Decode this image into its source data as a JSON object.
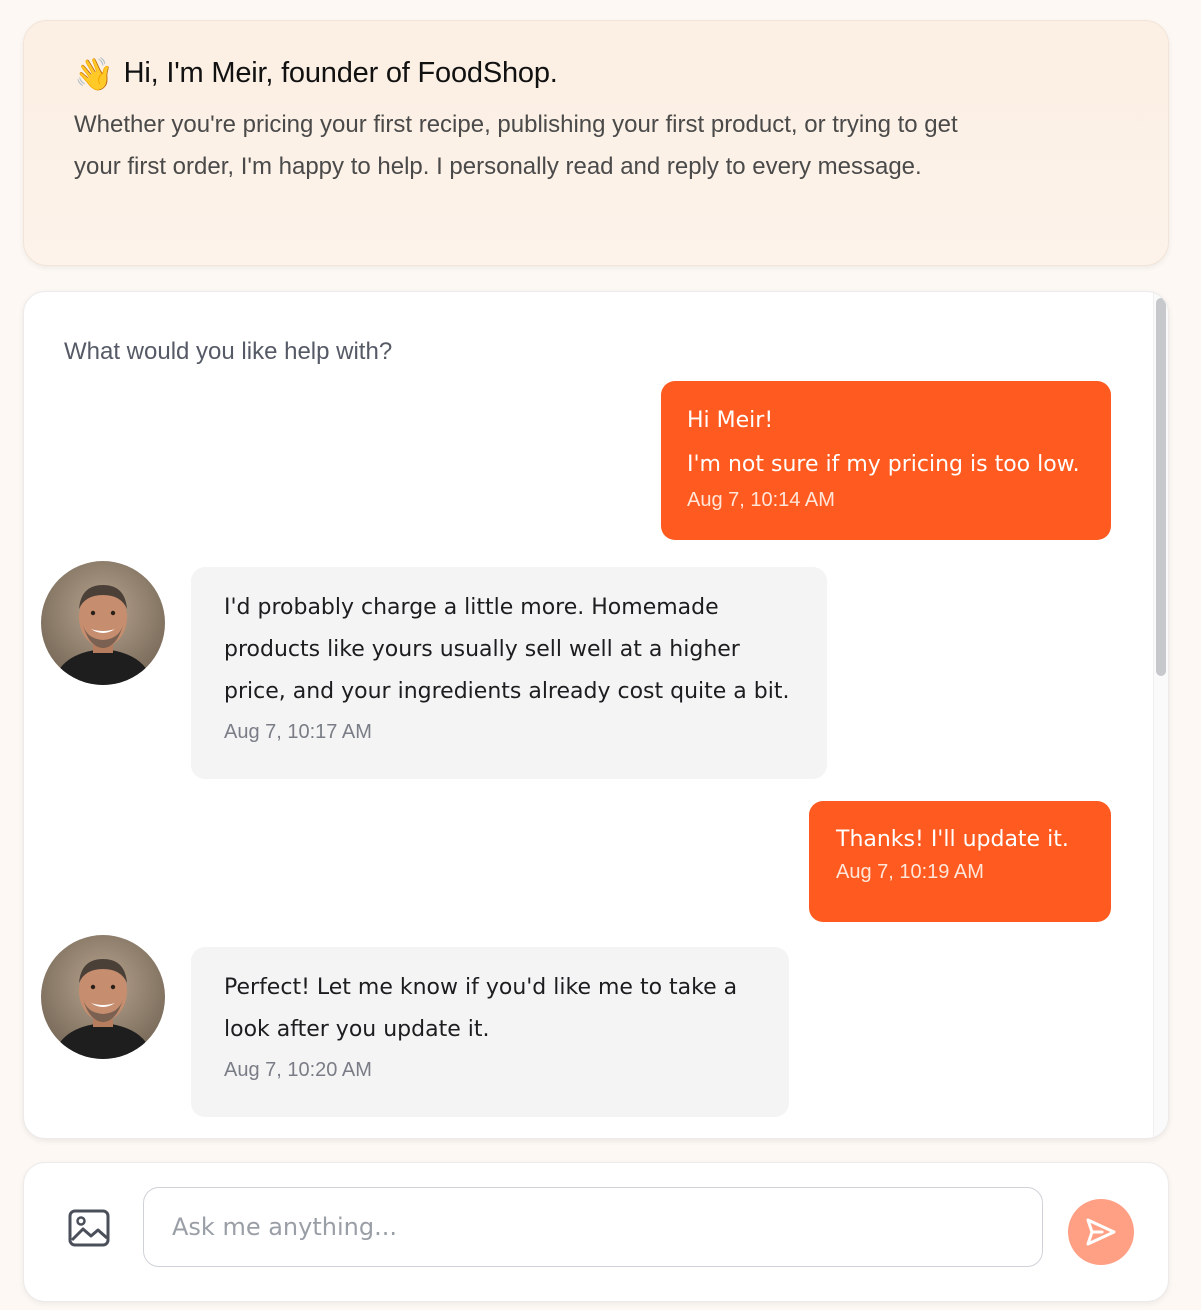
{
  "header": {
    "wave_emoji": "👋",
    "title": "Hi, I'm Meir, founder of FoodShop.",
    "description": "Whether you're pricing your first recipe, publishing your first product, or trying to get your first order, I'm happy to help. I personally read and reply to every message."
  },
  "chat": {
    "prompt": "What would you like help with?",
    "messages": [
      {
        "sender": "user",
        "lines": [
          "Hi Meir!",
          "I'm not sure if my pricing is too low."
        ],
        "time": "Aug 7, 10:14 AM"
      },
      {
        "sender": "founder",
        "text": "I'd probably charge a little more. Homemade products like yours usually sell well at a higher price, and your ingredients already cost quite a bit.",
        "time": "Aug 7, 10:17 AM"
      },
      {
        "sender": "user",
        "text": "Thanks! I'll update it.",
        "time": "Aug 7, 10:19 AM"
      },
      {
        "sender": "founder",
        "text": "Perfect! Let me know if you'd like me to take a look after you update it.",
        "time": "Aug 7, 10:20 AM"
      }
    ]
  },
  "composer": {
    "placeholder": "Ask me anything...",
    "attach_icon": "image-icon",
    "send_icon": "send-icon"
  },
  "colors": {
    "accent": "#ff5a1f",
    "send_button": "#ffa085",
    "page_background": "#fdf8f4"
  }
}
